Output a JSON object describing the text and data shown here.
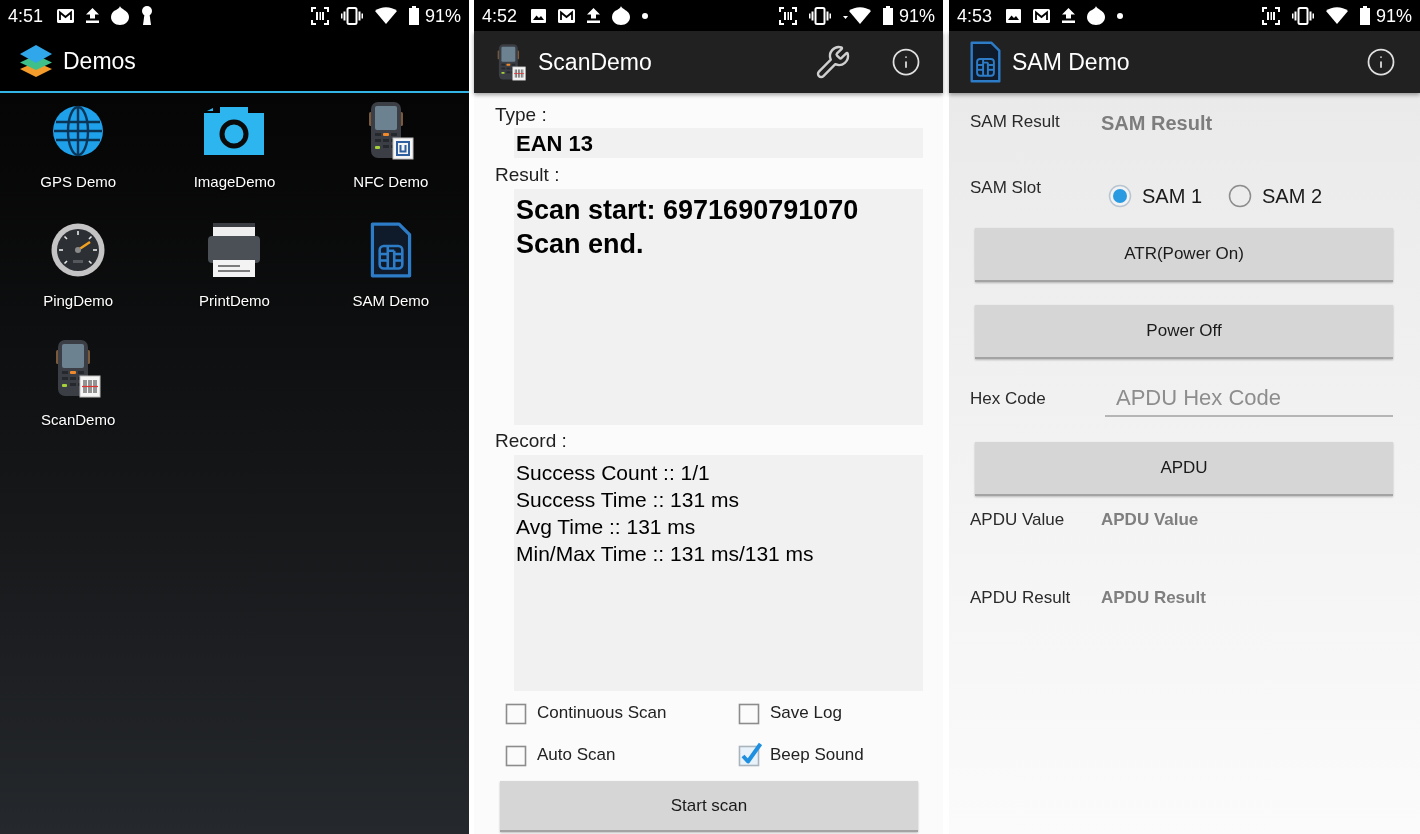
{
  "launcher": {
    "status_bar": {
      "time": "4:51",
      "battery": "91%"
    },
    "app_bar": {
      "title": "Demos"
    },
    "apps": [
      {
        "label": "GPS Demo"
      },
      {
        "label": "ImageDemo"
      },
      {
        "label": "NFC Demo"
      },
      {
        "label": "PingDemo"
      },
      {
        "label": "PrintDemo"
      },
      {
        "label": "SAM Demo"
      },
      {
        "label": "ScanDemo"
      }
    ]
  },
  "scan_demo": {
    "status_bar": {
      "time": "4:52",
      "battery": "91%"
    },
    "app_bar": {
      "title": "ScanDemo"
    },
    "type": {
      "label": "Type :",
      "value": "EAN 13"
    },
    "result": {
      "label": "Result :",
      "lines": [
        "Scan start: 6971690791070",
        "Scan end."
      ]
    },
    "record": {
      "label": "Record :",
      "lines": [
        "Success Count :: 1/1",
        "Success Time :: 131 ms",
        "Avg Time :: 131 ms",
        "Min/Max Time :: 131 ms/131 ms"
      ]
    },
    "options": [
      {
        "label": "Continuous Scan",
        "checked": false
      },
      {
        "label": "Save Log",
        "checked": false
      },
      {
        "label": "Auto Scan",
        "checked": false
      },
      {
        "label": "Beep Sound",
        "checked": true
      }
    ],
    "start_button": "Start scan"
  },
  "sam_demo": {
    "status_bar": {
      "time": "4:53",
      "battery": "91%"
    },
    "app_bar": {
      "title": "SAM Demo"
    },
    "sam_result": {
      "label": "SAM Result",
      "value": "SAM Result"
    },
    "sam_slot": {
      "label": "SAM Slot",
      "options": [
        {
          "label": "SAM 1",
          "selected": true
        },
        {
          "label": "SAM 2",
          "selected": false
        }
      ]
    },
    "atr_button": "ATR(Power On)",
    "power_off_button": "Power Off",
    "hex_code": {
      "label": "Hex Code",
      "placeholder": "APDU Hex Code"
    },
    "apdu_button": "APDU",
    "apdu_value": {
      "label": "APDU Value",
      "value": "APDU Value"
    },
    "apdu_result": {
      "label": "APDU Result",
      "value": "APDU Result"
    }
  }
}
